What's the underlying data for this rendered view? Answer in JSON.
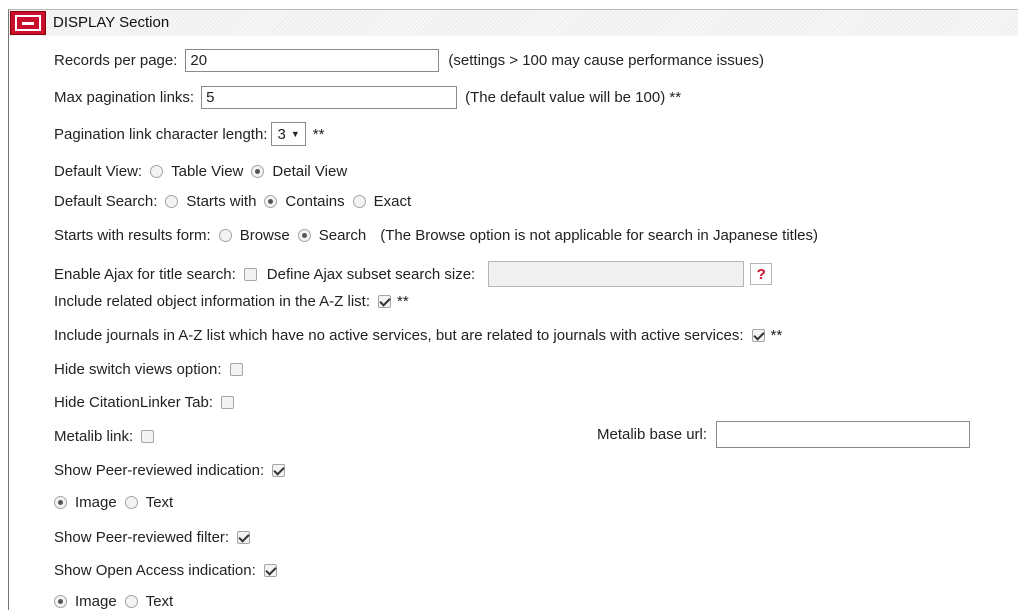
{
  "section": {
    "title": "DISPLAY Section",
    "toggle_icon": "minus-icon"
  },
  "records_per_page": {
    "label": "Records per page:",
    "value": "20",
    "note": "(settings > 100 may cause performance issues)"
  },
  "max_pagination": {
    "label": "Max pagination links:",
    "value": "5",
    "note": "(The default value will be 100) **"
  },
  "pagination_char_len": {
    "label": "Pagination link character length:",
    "value": "3",
    "note": "**"
  },
  "default_view": {
    "label": "Default View:",
    "options": [
      "Table View",
      "Detail View"
    ],
    "selected": "Detail View"
  },
  "default_search": {
    "label": "Default Search:",
    "options": [
      "Starts with",
      "Contains",
      "Exact"
    ],
    "selected": "Contains"
  },
  "starts_with_form": {
    "label": "Starts with results form:",
    "options": [
      "Browse",
      "Search"
    ],
    "selected": "Search",
    "note": "(The Browse option is not applicable for search in Japanese titles)"
  },
  "ajax": {
    "label": "Enable Ajax for title search:",
    "checked": false,
    "subset_label": "Define Ajax subset search size:",
    "subset_value": "",
    "help": "?"
  },
  "related_object": {
    "label": "Include related object information in the A-Z list:",
    "checked": true,
    "note": "**"
  },
  "journals_no_active": {
    "label": "Include journals in A-Z list which have no active services, but are related to journals with active services:",
    "checked": true,
    "note": "**"
  },
  "hide_switch_views": {
    "label": "Hide switch views option:",
    "checked": false
  },
  "hide_citationlinker": {
    "label": "Hide CitationLinker Tab:",
    "checked": false
  },
  "metalib": {
    "label": "Metalib link:",
    "checked": false,
    "url_label": "Metalib base url:",
    "url_value": ""
  },
  "peer_reviewed_indication": {
    "label": "Show Peer-reviewed indication:",
    "checked": true,
    "options": [
      "Image",
      "Text"
    ],
    "selected": "Image"
  },
  "peer_reviewed_filter": {
    "label": "Show Peer-reviewed filter:",
    "checked": true
  },
  "open_access_indication": {
    "label": "Show Open Access indication:",
    "checked": true,
    "options": [
      "Image",
      "Text"
    ],
    "selected": "Image"
  },
  "colors": {
    "accent": "#c8102e"
  }
}
